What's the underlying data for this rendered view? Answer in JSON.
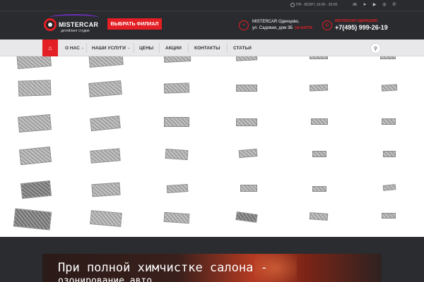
{
  "header": {
    "logo_name": "MISTERCAR",
    "logo_sub": "детейлинг студия",
    "branch_button": "ВЫБРАТЬ ФИЛИАЛ",
    "hours": "ПН - ВСКР | 10:00 - 20:00",
    "socials": [
      "vk",
      "tg",
      "yt",
      "ig",
      "wa"
    ],
    "address_line1": "MISTERCAR Одинцово,",
    "address_line2": "ул. Садовая, дом 3Б",
    "map_link": "НА КАРТЕ",
    "phone_label": "MISTERCAR ОДИНЦОВО",
    "phone": "+7(495) 999-26-19",
    "accent": "#e31e24"
  },
  "nav": {
    "items": [
      {
        "label": "О НАС",
        "has_dropdown": true
      },
      {
        "label": "НАШИ УСЛУГИ",
        "has_dropdown": true
      },
      {
        "label": "ЦЕНЫ",
        "has_dropdown": false
      },
      {
        "label": "АКЦИИ",
        "has_dropdown": false
      },
      {
        "label": "КОНТАКТЫ",
        "has_dropdown": false
      },
      {
        "label": "СТАТЬИ",
        "has_dropdown": false
      }
    ]
  },
  "banner": {
    "line1": "При полной химчистке салона -",
    "line2": "озонирование авто"
  }
}
